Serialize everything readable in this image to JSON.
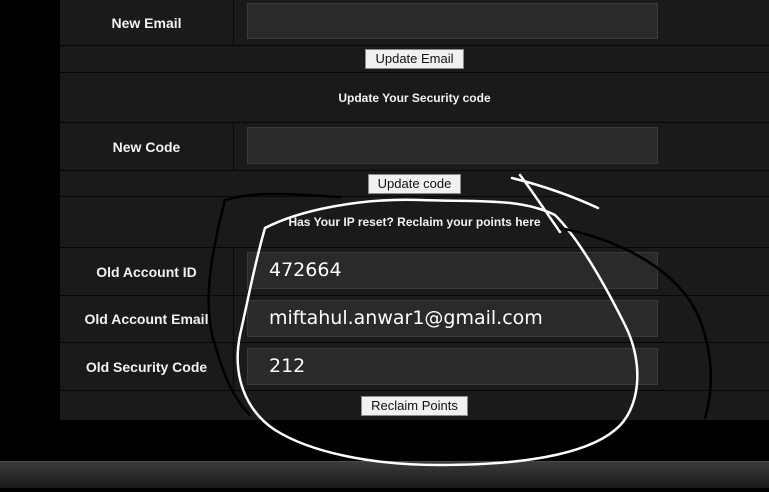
{
  "email": {
    "label": "New Email",
    "input_value": "",
    "button_label": "Update Email"
  },
  "security": {
    "section_title": "Update Your Security code",
    "label": "New Code",
    "input_value": "",
    "button_label": "Update code"
  },
  "reclaim": {
    "section_title": "Has Your IP reset? Reclaim your points here",
    "old_account_id_label": "Old Account ID",
    "old_account_id_value": "472664",
    "old_email_label": "Old Account Email",
    "old_email_value": "miftahul.anwar1@gmail.com",
    "old_code_label": "Old Security Code",
    "old_code_value": "212",
    "button_label": "Reclaim Points"
  }
}
